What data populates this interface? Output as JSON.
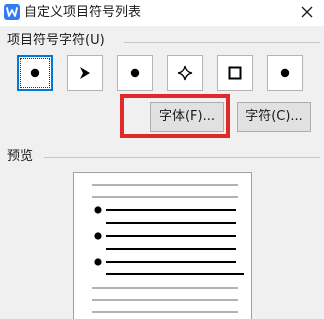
{
  "window": {
    "title": "自定义项目符号列表",
    "app_icon": "wps-writer-icon",
    "close_icon": "close-icon"
  },
  "bullets": {
    "label": "项目符号字符(U)",
    "selected_index": 0,
    "items": [
      {
        "name": "filled-circle-bullet",
        "glyph": "●"
      },
      {
        "name": "arrowhead-bullet",
        "glyph": "➢"
      },
      {
        "name": "filled-circle-bullet",
        "glyph": "●"
      },
      {
        "name": "four-point-star-bullet",
        "glyph": "✧"
      },
      {
        "name": "hollow-square-bullet",
        "glyph": "☐"
      },
      {
        "name": "filled-circle-bullet",
        "glyph": "●"
      }
    ]
  },
  "buttons": {
    "font": "字体(F)...",
    "character": "字符(C)..."
  },
  "preview": {
    "label": "预览",
    "bulleted_items": 3
  },
  "colors": {
    "highlight": "#e02a2a",
    "selection": "#0078d7",
    "app_icon": "#2f7cf6"
  }
}
